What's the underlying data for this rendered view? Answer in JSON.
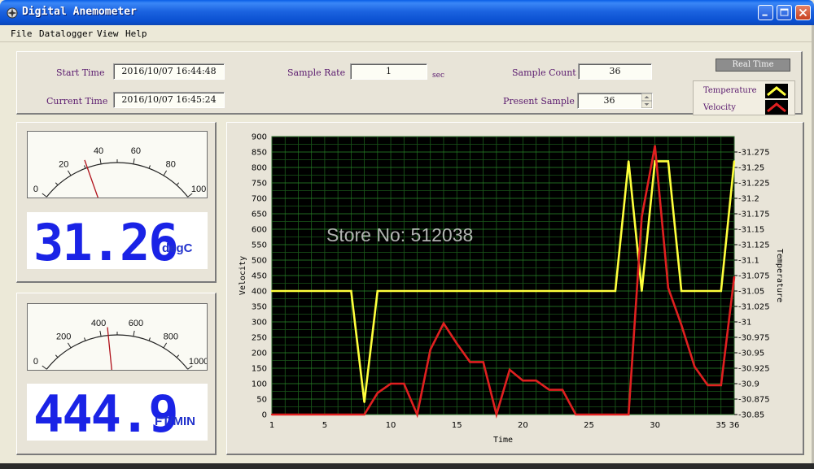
{
  "window": {
    "title": "Digital Anemometer"
  },
  "menu": [
    "File",
    "Datalogger",
    "View",
    "Help"
  ],
  "fields": {
    "start_time_label": "Start Time",
    "start_time": "2016/10/07 16:44:48",
    "current_time_label": "Current Time",
    "current_time": "2016/10/07 16:45:24",
    "sample_rate_label": "Sample Rate",
    "sample_rate": "1",
    "sample_rate_unit": "sec",
    "sample_count_label": "Sample Count",
    "sample_count": "36",
    "present_sample_label": "Present Sample",
    "present_sample": "36"
  },
  "realtime_label": "Real Time",
  "legend": [
    {
      "name": "Temperature",
      "color": "#ffff3c"
    },
    {
      "name": "Velocity",
      "color": "#e02020"
    }
  ],
  "temp_gauge": {
    "scale": [
      "0",
      "20",
      "40",
      "60",
      "80",
      "100"
    ],
    "min": 0,
    "max": 100,
    "value": 31.26,
    "readout": "31.26",
    "unit": "degC"
  },
  "velocity_gauge": {
    "scale": [
      "0",
      "200",
      "400",
      "600",
      "800",
      "1000"
    ],
    "min": 0,
    "max": 1000,
    "value": 444.9,
    "readout": "444.9",
    "unit": "FT/MIN"
  },
  "watermark": "Store No: 512038",
  "chart_data": {
    "type": "line",
    "xlabel": "Time",
    "ylabel": "Velocity",
    "y2label": "Temperature",
    "x_ticks": [
      "1",
      "5",
      "10",
      "15",
      "20",
      "25",
      "30",
      "35",
      "36"
    ],
    "x_tick_values": [
      1,
      5,
      10,
      15,
      20,
      25,
      30,
      35,
      36
    ],
    "y_ticks": [
      "0",
      "50",
      "100",
      "150",
      "200",
      "250",
      "300",
      "350",
      "400",
      "450",
      "500",
      "550",
      "600",
      "650",
      "700",
      "750",
      "800",
      "850",
      "900"
    ],
    "y2_ticks": [
      "-30.85",
      "-30.875",
      "-30.9",
      "-30.925",
      "-30.95",
      "-30.975",
      "-31",
      "-31.025",
      "-31.05",
      "-31.075",
      "-31.1",
      "-31.125",
      "-31.15",
      "-31.175",
      "-31.2",
      "-31.225",
      "-31.25",
      "-31.275"
    ],
    "xlim": [
      1,
      36
    ],
    "ylim": [
      0,
      900
    ],
    "y2lim": [
      -30.85,
      -31.3
    ],
    "grid": true,
    "series": [
      {
        "name": "Temperature",
        "color": "#ffff3c",
        "axis": "right",
        "x": [
          1,
          2,
          3,
          4,
          5,
          6,
          7,
          8,
          9,
          10,
          11,
          12,
          13,
          14,
          15,
          16,
          17,
          18,
          19,
          20,
          21,
          22,
          23,
          24,
          25,
          26,
          27,
          28,
          29,
          30,
          31,
          32,
          33,
          34,
          35,
          36
        ],
        "values": [
          -31.05,
          -31.05,
          -31.05,
          -31.05,
          -31.05,
          -31.05,
          -31.05,
          -30.87,
          -31.05,
          -31.05,
          -31.05,
          -31.05,
          -31.05,
          -31.05,
          -31.05,
          -31.05,
          -31.05,
          -31.05,
          -31.05,
          -31.05,
          -31.05,
          -31.05,
          -31.05,
          -31.05,
          -31.05,
          -31.05,
          -31.05,
          -31.26,
          -31.05,
          -31.26,
          -31.26,
          -31.05,
          -31.05,
          -31.05,
          -31.05,
          -31.26
        ]
      },
      {
        "name": "Velocity",
        "color": "#e02020",
        "axis": "left",
        "x": [
          1,
          2,
          3,
          4,
          5,
          6,
          7,
          8,
          9,
          10,
          11,
          12,
          13,
          14,
          15,
          16,
          17,
          18,
          19,
          20,
          21,
          22,
          23,
          24,
          25,
          26,
          27,
          28,
          29,
          30,
          31,
          32,
          33,
          34,
          35,
          36
        ],
        "values": [
          0,
          0,
          0,
          0,
          0,
          0,
          0,
          0,
          70,
          100,
          100,
          0,
          210,
          295,
          230,
          170,
          170,
          0,
          145,
          110,
          110,
          80,
          80,
          0,
          0,
          0,
          0,
          0,
          640,
          870,
          410,
          290,
          155,
          95,
          95,
          445
        ]
      }
    ]
  }
}
